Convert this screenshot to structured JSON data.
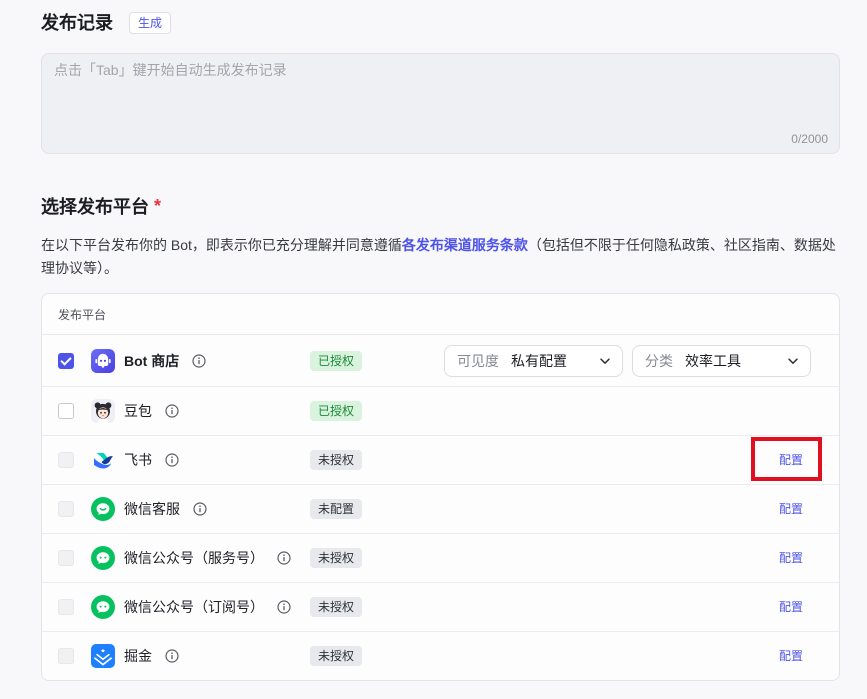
{
  "colors": {
    "accent": "#4d53e8",
    "required": "#f0323c",
    "authorized_bg": "#daf3df",
    "authorized_text": "#1b8a37",
    "pending_bg": "#e8e9ec",
    "pending_text": "#2f3238",
    "highlight": "#e0101e",
    "wechat_green": "#07c160",
    "juejin_blue": "#1e80ff"
  },
  "release_notes": {
    "title": "发布记录",
    "generate_label": "生成",
    "placeholder": "点击「Tab」键开始自动生成发布记录",
    "value": "",
    "counter": "0/2000"
  },
  "platforms": {
    "title": "选择发布平台",
    "required_mark": "*",
    "description_before": "在以下平台发布你的 Bot，即表示你已充分理解并同意遵循",
    "terms_link": "各发布渠道服务条款",
    "description_after": "（包括但不限于任何隐私政策、社区指南、数据处理协议等）。",
    "table": {
      "header": "发布平台",
      "rows": [
        {
          "name": "Bot 商店",
          "icon": "bot-store-icon",
          "checked": true,
          "disabled": false,
          "status": "已授权",
          "visibility": {
            "label": "可见度",
            "value": "私有配置"
          },
          "category": {
            "label": "分类",
            "value": "效率工具"
          }
        },
        {
          "name": "豆包",
          "icon": "doubao-avatar-icon",
          "checked": false,
          "disabled": false,
          "status": "已授权"
        },
        {
          "name": "飞书",
          "icon": "feishu-icon",
          "checked": false,
          "disabled": true,
          "status": "未授权",
          "action": "配置"
        },
        {
          "name": "微信客服",
          "icon": "wechat-service-icon",
          "checked": false,
          "disabled": true,
          "status": "未配置",
          "action": "配置"
        },
        {
          "name": "微信公众号（服务号）",
          "icon": "wechat-official-account-icon",
          "checked": false,
          "disabled": true,
          "status": "未授权",
          "action": "配置"
        },
        {
          "name": "微信公众号（订阅号）",
          "icon": "wechat-official-account-icon",
          "checked": false,
          "disabled": true,
          "status": "未授权",
          "action": "配置"
        },
        {
          "name": "掘金",
          "icon": "juejin-icon",
          "checked": false,
          "disabled": true,
          "status": "未授权",
          "action": "配置"
        }
      ]
    }
  }
}
